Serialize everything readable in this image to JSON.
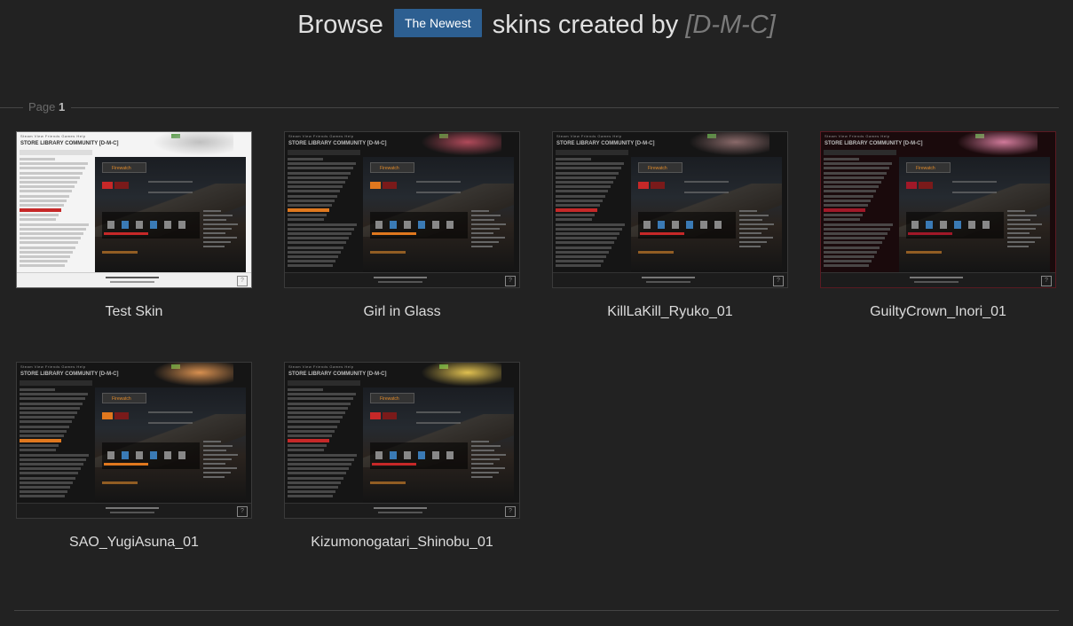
{
  "header": {
    "prefix": "Browse",
    "sort_badge": "The Newest",
    "middle": "skins created by",
    "author": "[D-M-C]"
  },
  "pager": {
    "label": "Page",
    "current": "1"
  },
  "skins": [
    {
      "title": "Test Skin",
      "theme": "light",
      "accent": "#c62828",
      "deco_color": "#c0c0c0"
    },
    {
      "title": "Girl in Glass",
      "theme": "dark",
      "accent": "#e0781e",
      "deco_color": "#b04a5a"
    },
    {
      "title": "KillLaKill_Ryuko_01",
      "theme": "dark",
      "accent": "#c62828",
      "deco_color": "#8a6a6a"
    },
    {
      "title": "GuiltyCrown_Inori_01",
      "theme": "dark-red",
      "accent": "#a01828",
      "deco_color": "#d07a9a"
    },
    {
      "title": "SAO_YugiAsuna_01",
      "theme": "dark",
      "accent": "#e0781e",
      "deco_color": "#d89050"
    },
    {
      "title": "Kizumonogatari_Shinobu_01",
      "theme": "dark",
      "accent": "#c62828",
      "deco_color": "#e0c050"
    }
  ],
  "mock_ui": {
    "nav": "STORE  LIBRARY  COMMUNITY  [D-M-C]",
    "game": "Firewatch",
    "help": "?"
  }
}
